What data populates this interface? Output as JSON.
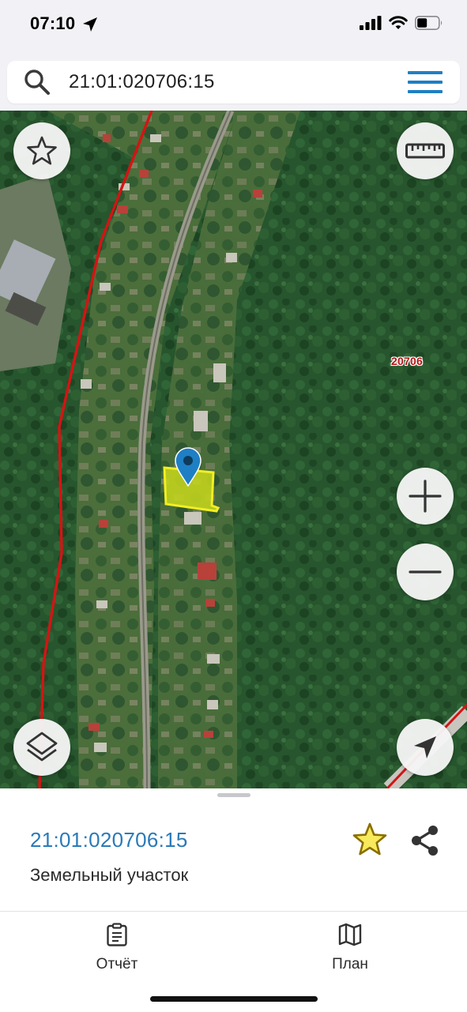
{
  "status_bar": {
    "time": "07:10",
    "icons": [
      "location-arrow-icon",
      "cellular-signal-icon",
      "wifi-icon",
      "battery-icon"
    ]
  },
  "search": {
    "value": "21:01:020706:15",
    "icon": "search-icon",
    "menu_icon": "menu-icon"
  },
  "map": {
    "quarter_label": "20706",
    "controls": {
      "favorites": "star-outline-icon",
      "measure": "ruler-icon",
      "zoom_in": "plus-icon",
      "zoom_out": "minus-icon",
      "layers": "layers-icon",
      "locate": "navigation-arrow-icon"
    },
    "colors": {
      "parcel_fill": "#c8d81c",
      "parcel_outline": "#f2ee22",
      "boundary_line": "#d41414",
      "marker": "#1f7fc4"
    }
  },
  "sheet": {
    "title": "21:01:020706:15",
    "subtitle": "Земельный участок",
    "favorite_color": "#d8c012",
    "accent": "#2a7ab8"
  },
  "tabs": [
    {
      "label": "Отчёт",
      "icon": "clipboard-icon"
    },
    {
      "label": "План",
      "icon": "map-icon"
    }
  ]
}
